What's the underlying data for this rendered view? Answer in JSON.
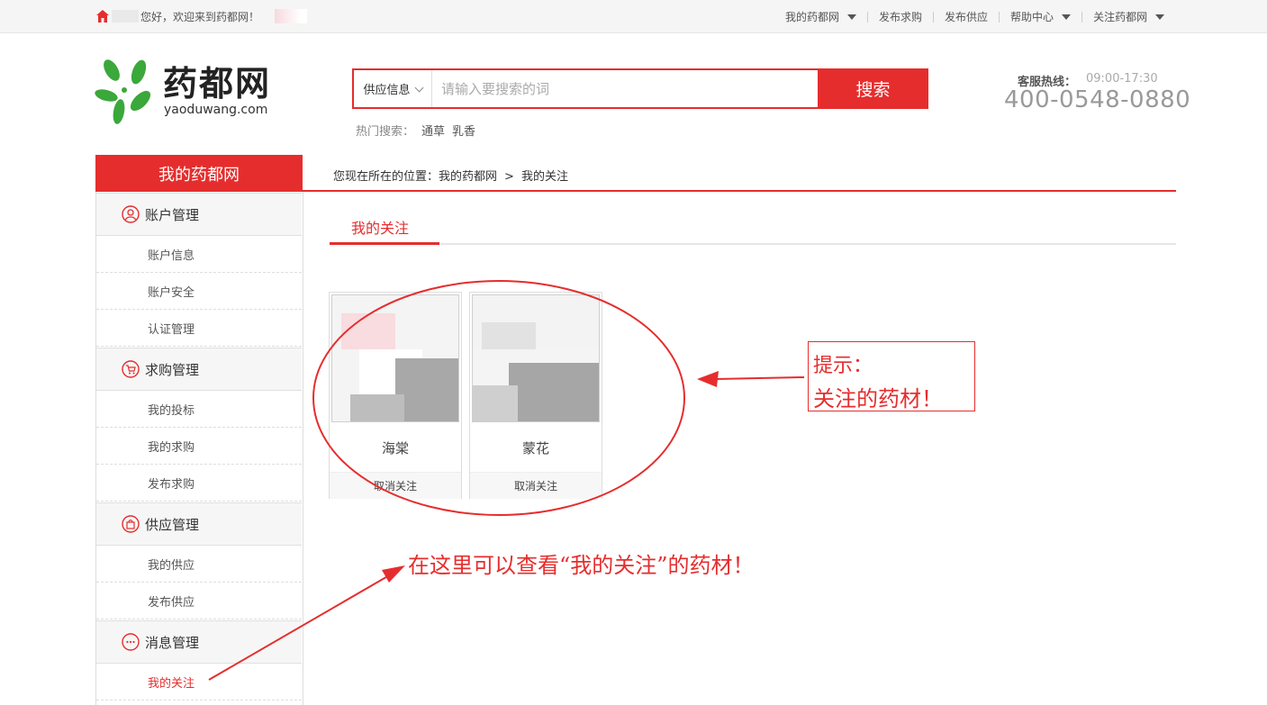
{
  "topbar": {
    "welcome": "您好，欢迎来到药都网！",
    "nav": [
      {
        "label": "我的药都网",
        "dropdown": true
      },
      {
        "label": "发布求购",
        "dropdown": false
      },
      {
        "label": "发布供应",
        "dropdown": false
      },
      {
        "label": "帮助中心",
        "dropdown": true
      },
      {
        "label": "关注药都网",
        "dropdown": true
      }
    ]
  },
  "logo": {
    "cn": "药都网",
    "en": "yaoduwang.com"
  },
  "search": {
    "category": "供应信息",
    "placeholder": "请输入要搜索的词",
    "button": "搜索",
    "hot_label": "热门搜索：",
    "hot_keywords": [
      "通草",
      "乳香"
    ]
  },
  "hotline": {
    "label": "客服热线：",
    "hours": "09:00-17:30",
    "number": "400-0548-0880"
  },
  "sidebar": {
    "title": "我的药都网",
    "groups": [
      {
        "label": "账户管理",
        "icon": "user-circle-icon",
        "items": [
          "账户信息",
          "账户安全",
          "认证管理"
        ]
      },
      {
        "label": "求购管理",
        "icon": "cart-circle-icon",
        "items": [
          "我的投标",
          "我的求购",
          "发布求购"
        ]
      },
      {
        "label": "供应管理",
        "icon": "bag-circle-icon",
        "items": [
          "我的供应",
          "发布供应"
        ]
      },
      {
        "label": "消息管理",
        "icon": "chat-circle-icon",
        "items": [
          "我的关注"
        ]
      }
    ],
    "active_item": "我的关注"
  },
  "breadcrumb": {
    "prefix": "您现在所在的位置：",
    "path": [
      "我的药都网",
      "我的关注"
    ],
    "separator": ">"
  },
  "tab": {
    "label": "我的关注"
  },
  "favorites": [
    {
      "name": "海棠",
      "action": "取消关注"
    },
    {
      "name": "蒙花",
      "action": "取消关注"
    }
  ],
  "annotations": {
    "tip_title": "提示：",
    "tip_body": "关注的药材！",
    "note": "在这里可以查看“我的关注”的药材！"
  },
  "colors": {
    "accent": "#e62d2d",
    "logo_green": "#3aa83a"
  }
}
